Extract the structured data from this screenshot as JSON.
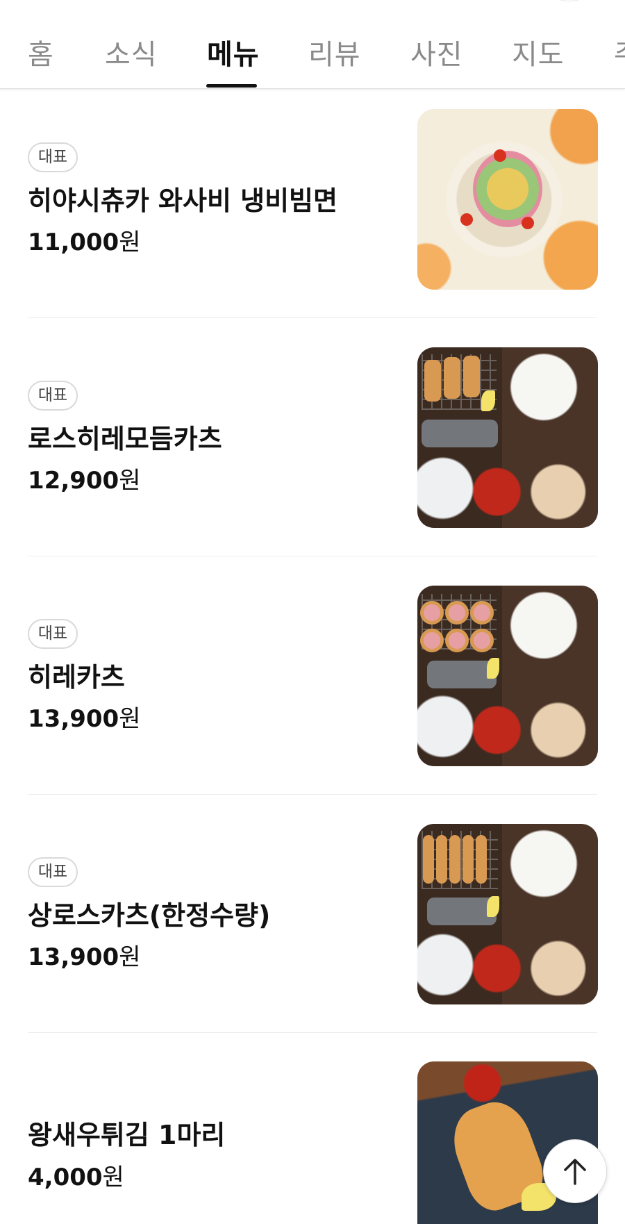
{
  "tabs": [
    {
      "label": "홈",
      "active": false
    },
    {
      "label": "소식",
      "active": false
    },
    {
      "label": "메뉴",
      "active": true
    },
    {
      "label": "리뷰",
      "active": false
    },
    {
      "label": "사진",
      "active": false
    },
    {
      "label": "지도",
      "active": false
    },
    {
      "label": "주",
      "active": false
    }
  ],
  "menu": {
    "items": [
      {
        "badge": "대표",
        "name": "히야시츄카 와사비 냉비빔면",
        "price": "11,000",
        "currency": "원",
        "image": "cold-noodle-photo"
      },
      {
        "badge": "대표",
        "name": "로스히레모듬카츠",
        "price": "12,900",
        "currency": "원",
        "image": "katsu-set-photo"
      },
      {
        "badge": "대표",
        "name": "히레카츠",
        "price": "13,900",
        "currency": "원",
        "image": "hire-katsu-set-photo"
      },
      {
        "badge": "대표",
        "name": "상로스카츠(한정수량)",
        "price": "13,900",
        "currency": "원",
        "image": "rosu-katsu-set-photo"
      },
      {
        "badge": "",
        "name": "왕새우튀김 1마리",
        "price": "4,000",
        "currency": "원",
        "image": "fried-shrimp-photo"
      }
    ]
  },
  "scroll_top": {
    "icon": "arrow-up-icon"
  },
  "colors": {
    "active_tab": "#111111",
    "inactive_tab": "#8a8a8a",
    "divider": "#ececec",
    "badge_border": "#d9d9d9"
  }
}
